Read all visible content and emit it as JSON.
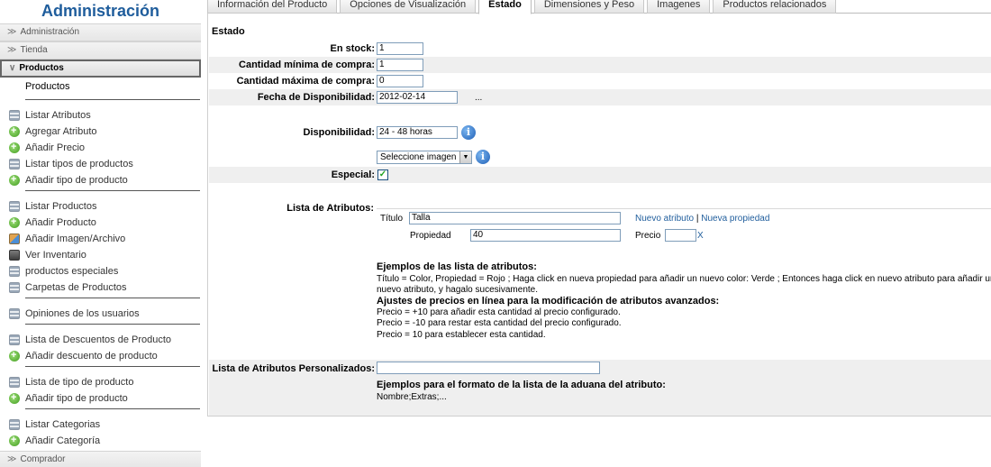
{
  "sidebar": {
    "title": "Administración",
    "sections": {
      "administracion": "Administración",
      "tienda": "Tienda",
      "productos": "Productos",
      "comprador": "Comprador"
    },
    "sub_header": "Productos",
    "items": [
      {
        "label": "Listar Atributos",
        "icon": "list-icon"
      },
      {
        "label": "Agregar Atributo",
        "icon": "add-icon"
      },
      {
        "label": "Añadir Precio",
        "icon": "add-icon"
      },
      {
        "label": "Listar tipos de productos",
        "icon": "list-icon"
      },
      {
        "label": "Añadir tipo de producto",
        "icon": "add-icon"
      },
      {
        "label": "Listar Productos",
        "icon": "list-icon"
      },
      {
        "label": "Añadir Producto",
        "icon": "add-icon"
      },
      {
        "label": "Añadir Imagen/Archivo",
        "icon": "image-icon"
      },
      {
        "label": "Ver Inventario",
        "icon": "inventory-icon"
      },
      {
        "label": "productos especiales",
        "icon": "list-icon"
      },
      {
        "label": "Carpetas de Productos",
        "icon": "list-icon"
      },
      {
        "label": "Opiniones de los usuarios",
        "icon": "list-icon"
      },
      {
        "label": "Lista de Descuentos de Producto",
        "icon": "list-icon"
      },
      {
        "label": "Añadir descuento de producto",
        "icon": "add-icon"
      },
      {
        "label": "Lista de tipo de producto",
        "icon": "list-icon"
      },
      {
        "label": "Añadir tipo de producto",
        "icon": "add-icon"
      },
      {
        "label": "Listar Categorias",
        "icon": "list-icon"
      },
      {
        "label": "Añadir Categoría",
        "icon": "add-icon"
      }
    ]
  },
  "tabs": [
    {
      "label": "Información del Producto",
      "active": false
    },
    {
      "label": "Opciones de Visualización",
      "active": false
    },
    {
      "label": "Estado",
      "active": true
    },
    {
      "label": "Dimensiones y Peso",
      "active": false
    },
    {
      "label": "Imagenes",
      "active": false
    },
    {
      "label": "Productos relacionados",
      "active": false
    }
  ],
  "form": {
    "section_title": "Estado",
    "en_stock": {
      "label": "En stock:",
      "value": "1"
    },
    "cantidad_minima": {
      "label": "Cantidad mínima de compra:",
      "value": "1"
    },
    "cantidad_maxima": {
      "label": "Cantidad máxima de compra:",
      "value": "0"
    },
    "fecha_disponibilidad": {
      "label": "Fecha de Disponibilidad:",
      "value": "2012-02-14",
      "picker": "..."
    },
    "disponibilidad": {
      "label": "Disponibilidad:",
      "value": "24 - 48 horas"
    },
    "imagen_select": {
      "value": "Seleccione imagen"
    },
    "especial": {
      "label": "Especial:",
      "checked": true,
      "check_glyph": "✓"
    },
    "lista_atributos": {
      "label": "Lista de Atributos:",
      "titulo_label": "Título",
      "titulo_value": "Talla",
      "nuevo_atributo": "Nuevo atributo",
      "separator": "|",
      "nueva_propiedad": "Nueva propiedad",
      "propiedad_label": "Propiedad",
      "propiedad_value": "40",
      "precio_label": "Precio",
      "precio_value": "",
      "delete": "X"
    },
    "ejemplos": {
      "heading": "Ejemplos de las lista de atributos:",
      "line1": "Título = Color, Propiedad = Rojo ; Haga click en nueva propiedad para añadir un nuevo color: Verde ; Entonces haga click en nuevo atributo para añadir un",
      "line2": "nuevo atributo, y hagalo sucesivamente.",
      "heading2": "Ajustes de precios en línea para la modificación de atributos avanzados:",
      "p1": "Precio = +10 para añadir esta cantidad al precio configurado.",
      "p2": "Precio = -10 para restar esta cantidad del precio configurado.",
      "p3": "Precio = 10 para establecer esta cantidad."
    },
    "personalizados": {
      "label": "Lista de Atributos Personalizados:",
      "value": "",
      "heading": "Ejemplos para el formato de la lista de la aduana del atributo:",
      "example": "Nombre;Extras;..."
    }
  }
}
